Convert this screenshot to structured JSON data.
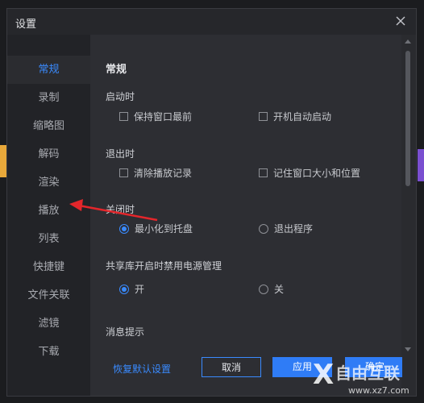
{
  "window": {
    "title": "设置"
  },
  "sidebar": {
    "items": [
      {
        "label": "常规",
        "active": true
      },
      {
        "label": "录制"
      },
      {
        "label": "缩略图"
      },
      {
        "label": "解码"
      },
      {
        "label": "渲染"
      },
      {
        "label": "播放"
      },
      {
        "label": "列表"
      },
      {
        "label": "快捷键"
      },
      {
        "label": "文件关联"
      },
      {
        "label": "滤镜"
      },
      {
        "label": "下载"
      }
    ]
  },
  "general": {
    "title": "常规",
    "startup": {
      "label": "启动时",
      "options": [
        {
          "label": "保持窗口最前",
          "checked": false
        },
        {
          "label": "开机自动启动",
          "checked": false
        }
      ]
    },
    "exit": {
      "label": "退出时",
      "options": [
        {
          "label": "清除播放记录",
          "checked": false
        },
        {
          "label": "记住窗口大小和位置",
          "checked": false
        }
      ]
    },
    "close": {
      "label": "关闭时",
      "options": [
        {
          "label": "最小化到托盘",
          "selected": true
        },
        {
          "label": "退出程序",
          "selected": false
        }
      ]
    },
    "power": {
      "label": "共享库开启时禁用电源管理",
      "options": [
        {
          "label": "开",
          "selected": true
        },
        {
          "label": "关",
          "selected": false
        }
      ]
    },
    "notify": {
      "label": "消息提示"
    }
  },
  "footer": {
    "reset": "恢复默认设置",
    "cancel": "取消",
    "apply": "应用",
    "ok": "确定"
  },
  "watermark": {
    "text": "自由互联",
    "url": "www.xz7.com"
  },
  "colors": {
    "accent": "#3a8bff",
    "annotation_arrow": "#e3262b"
  }
}
